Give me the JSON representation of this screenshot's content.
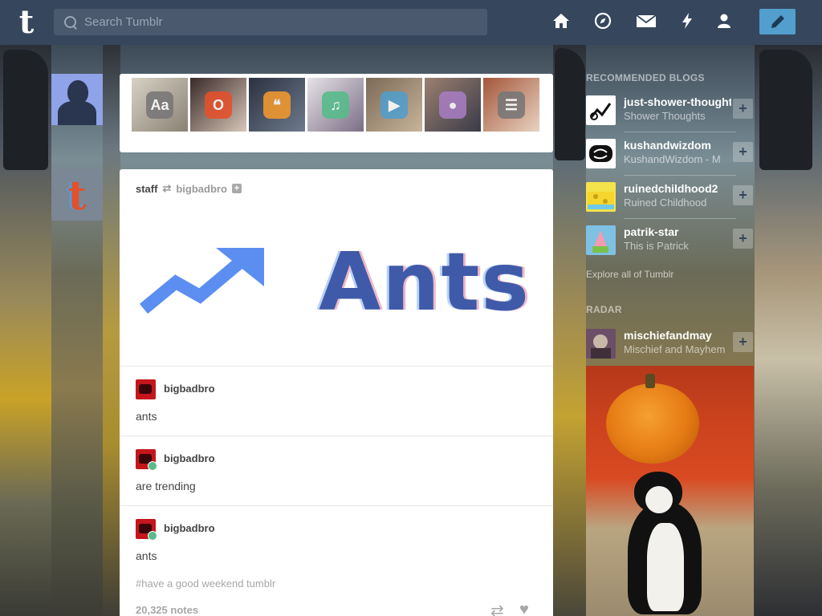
{
  "search": {
    "placeholder": "Search Tumblr"
  },
  "nav": {
    "home_icon": "home-icon",
    "explore_icon": "compass-icon",
    "inbox_icon": "envelope-icon",
    "activity_icon": "lightning-icon",
    "account_icon": "person-icon",
    "compose_icon": "pencil-icon"
  },
  "colors": {
    "header": "#36465d",
    "compose": "#529ecc",
    "reblog_badge": "#56bc8a"
  },
  "trending": {
    "thumbs": [
      {
        "badge": "Aa",
        "badge_color": "#777777"
      },
      {
        "badge": "O",
        "badge_color": "#e4502b"
      },
      {
        "badge": "❝",
        "badge_color": "#f2992e"
      },
      {
        "badge": "♫",
        "badge_color": "#56bc8a"
      },
      {
        "badge": "▶",
        "badge_color": "#529ecc"
      },
      {
        "badge": "●",
        "badge_color": "#a77dc2"
      },
      {
        "badge": "☰",
        "badge_color": "#777777"
      }
    ]
  },
  "post": {
    "author": "staff",
    "reblogged_from": "bigbadbro",
    "image_text": "Ants",
    "thread": [
      {
        "name": "bigbadbro",
        "text": "ants"
      },
      {
        "name": "bigbadbro",
        "text": "are trending"
      },
      {
        "name": "bigbadbro",
        "text": "ants"
      }
    ],
    "tags": "#have a good weekend tumblr",
    "notes": "20,325 notes"
  },
  "sidebar": {
    "recommended_heading": "RECOMMENDED BLOGS",
    "blogs": [
      {
        "name": "just-shower-thoughts",
        "subtitle": "Shower Thoughts"
      },
      {
        "name": "kushandwizdom",
        "subtitle": "KushandWizdom - M"
      },
      {
        "name": "ruinedchildhood2",
        "subtitle": "Ruined Childhood"
      },
      {
        "name": "patrik-star",
        "subtitle": "This is Patrick"
      }
    ],
    "explore_link": "Explore all of Tumblr",
    "radar_heading": "RADAR",
    "radar": {
      "name": "mischiefandmay",
      "subtitle": "Mischief and Mayhem"
    }
  }
}
